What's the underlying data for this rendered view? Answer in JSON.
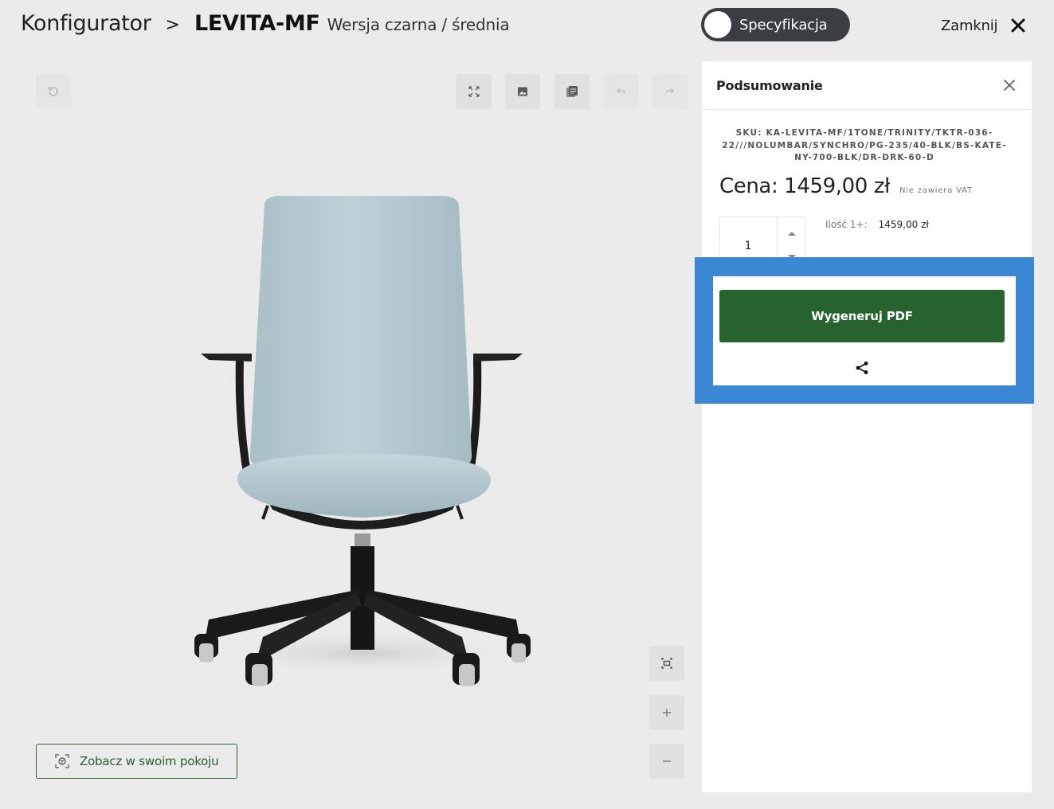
{
  "header": {
    "breadcrumb_root": "Konfigurator",
    "breadcrumb_separator": ">",
    "product_name": "LEVITA-MF",
    "variant": "Wersja czarna / średnia",
    "spec_toggle_label": "Specyfikacja",
    "close_label": "Zamknij"
  },
  "viewer": {
    "toolbar": [
      "reset-icon",
      "fullscreen-icon",
      "image-icon",
      "pdf-icon",
      "undo-icon",
      "redo-icon"
    ],
    "zoom_controls": [
      "fit-icon",
      "zoom-in-icon",
      "zoom-out-icon"
    ],
    "room_button_label": "Zobacz w swoim pokoju"
  },
  "summary": {
    "title": "Podsumowanie",
    "sku": "SKU: KA-LEVITA-MF/1TONE/TRINITY/TKTR-036-22///NOLUMBAR/SYNCHRO/PG-235/40-BLK/BS-KATE-NY-700-BLK/DR-DRK-60-D",
    "price": "Cena: 1459,00 zł",
    "vat_note": "Nie zawiera VAT",
    "quantity": "1",
    "tier_label": "Ilość 1+:",
    "tier_price": "1459,00 zł",
    "generate_pdf_label": "Wygeneruj PDF"
  },
  "colors": {
    "accent_green": "#27632f",
    "highlight_blue": "#3a87d3",
    "toggle_dark": "#3a3d41",
    "seat_fabric": "#b8cdd3"
  }
}
